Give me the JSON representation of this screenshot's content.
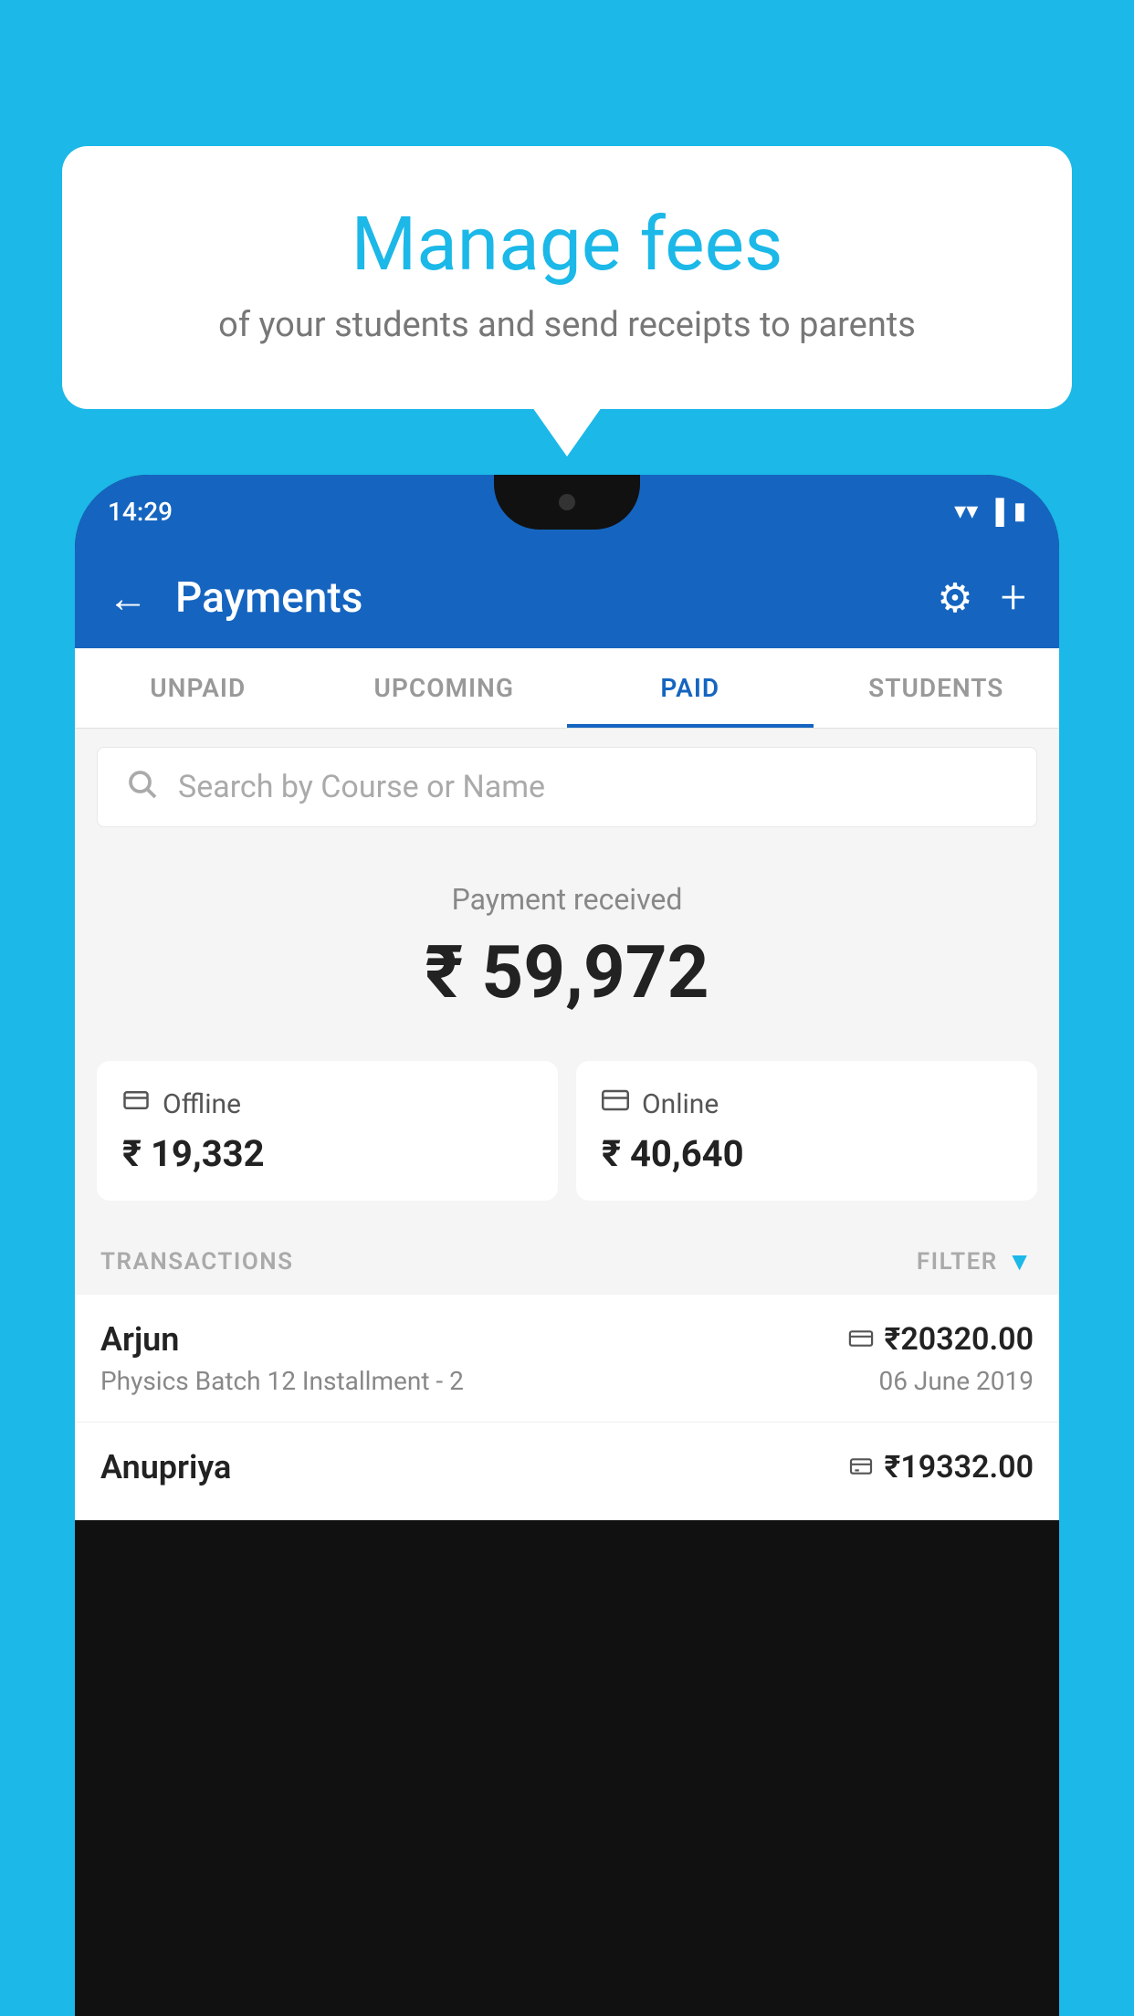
{
  "background": {
    "color": "#1BB8E8"
  },
  "tooltip": {
    "title": "Manage fees",
    "subtitle": "of your students and send receipts to parents"
  },
  "phone": {
    "status_bar": {
      "time": "14:29"
    },
    "header": {
      "title": "Payments",
      "back_label": "←",
      "gear_label": "⚙",
      "plus_label": "+"
    },
    "tabs": [
      {
        "label": "UNPAID",
        "active": false
      },
      {
        "label": "UPCOMING",
        "active": false
      },
      {
        "label": "PAID",
        "active": true
      },
      {
        "label": "STUDENTS",
        "active": false
      }
    ],
    "search": {
      "placeholder": "Search by Course or Name"
    },
    "payment_summary": {
      "label": "Payment received",
      "amount": "₹ 59,972",
      "offline_label": "Offline",
      "offline_amount": "₹ 19,332",
      "online_label": "Online",
      "online_amount": "₹ 40,640"
    },
    "transactions": {
      "header_label": "TRANSACTIONS",
      "filter_label": "FILTER",
      "rows": [
        {
          "name": "Arjun",
          "course": "Physics Batch 12 Installment - 2",
          "date": "06 June 2019",
          "amount": "₹20320.00",
          "type": "online"
        },
        {
          "name": "Anupriya",
          "course": "",
          "date": "",
          "amount": "₹19332.00",
          "type": "offline"
        }
      ]
    }
  }
}
